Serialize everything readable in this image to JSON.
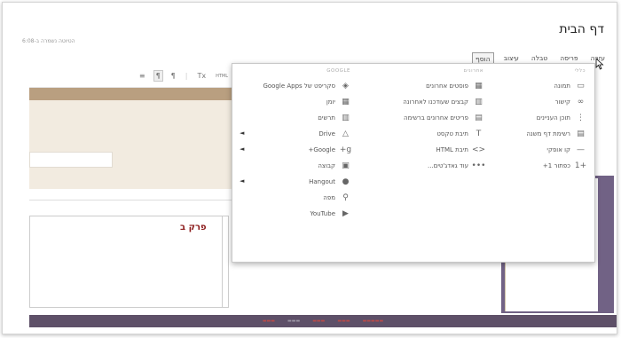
{
  "page": {
    "title": "דף הבית",
    "saved": "הטיוטה נשמרה ב-6:08"
  },
  "menubar": [
    {
      "label": "הוסף",
      "active": true
    },
    {
      "label": "עיצוב",
      "active": false
    },
    {
      "label": "טבלה",
      "active": false
    },
    {
      "label": "פריסה",
      "active": false
    },
    {
      "label": "עזרה",
      "active": false
    }
  ],
  "toolbar": {
    "html": "HTML",
    "clear": "Tx",
    "ltr": "¶",
    "rtl": "¶",
    "align": "≡"
  },
  "section": {
    "label": "פרק ב"
  },
  "dropdown": {
    "col1": {
      "header": "כללי",
      "items": [
        {
          "icon": "image-icon",
          "glyph": "▭",
          "label": "תמונה"
        },
        {
          "icon": "link-icon",
          "glyph": "∞",
          "label": "קישור"
        },
        {
          "icon": "toc-icon",
          "glyph": "⋮",
          "label": "תוכן העניינים"
        },
        {
          "icon": "subpage-list-icon",
          "glyph": "▤",
          "label": "רשימת דף משנה"
        },
        {
          "icon": "horizontal-line-icon",
          "glyph": "—",
          "label": "קו אופקי"
        },
        {
          "icon": "plus-one-icon",
          "glyph": "+1",
          "label": "כפתור 1+"
        }
      ]
    },
    "col2": {
      "header": "אחרונים",
      "items": [
        {
          "icon": "recent-posts-icon",
          "glyph": "▦",
          "label": "פוסטים אחרונים"
        },
        {
          "icon": "recent-files-icon",
          "glyph": "▥",
          "label": "קבצים שעודכנו לאחרונה"
        },
        {
          "icon": "recent-list-icon",
          "glyph": "▤",
          "label": "פריטים אחרונים ברשימה"
        },
        {
          "icon": "text-box-icon",
          "glyph": "T",
          "label": "תיבת טקסט"
        },
        {
          "icon": "html-box-icon",
          "glyph": "<>",
          "label": "תיבת HTML"
        },
        {
          "icon": "more-gadgets-icon",
          "glyph": "•••",
          "label": "עוד גאדג'טים..."
        }
      ]
    },
    "col3": {
      "header": "GOOGLE",
      "items": [
        {
          "icon": "apps-script-icon",
          "glyph": "◈",
          "label": "סקריפט של Google Apps",
          "submenu": false
        },
        {
          "icon": "calendar-icon",
          "glyph": "▦",
          "label": "יומן",
          "submenu": false
        },
        {
          "icon": "chart-icon",
          "glyph": "▥",
          "label": "תרשים",
          "submenu": false
        },
        {
          "icon": "drive-icon",
          "glyph": "△",
          "label": "Drive",
          "submenu": true
        },
        {
          "icon": "google-plus-icon",
          "glyph": "g+",
          "label": "Google+",
          "submenu": true
        },
        {
          "icon": "group-icon",
          "glyph": "▣",
          "label": "קבוצה",
          "submenu": false
        },
        {
          "icon": "hangout-icon",
          "glyph": "●",
          "label": "Hangout",
          "submenu": true
        },
        {
          "icon": "map-icon",
          "glyph": "⚲",
          "label": "מפה",
          "submenu": false
        },
        {
          "icon": "youtube-icon",
          "glyph": "▶",
          "label": "YouTube",
          "submenu": false
        }
      ]
    }
  }
}
